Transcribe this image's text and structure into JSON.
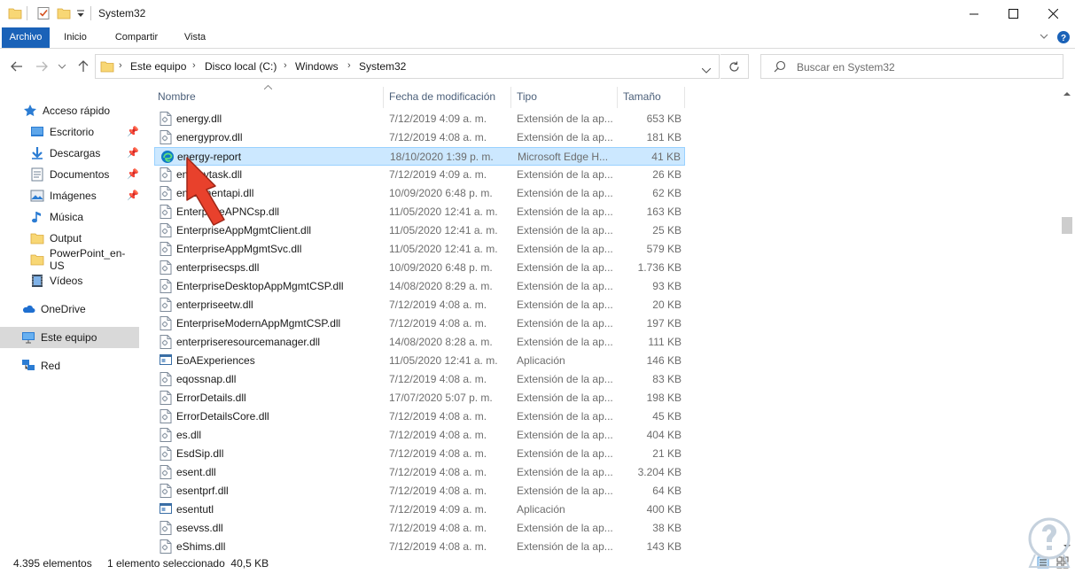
{
  "window": {
    "title": "System32"
  },
  "ribbon": {
    "tabs": [
      "Archivo",
      "Inicio",
      "Compartir",
      "Vista"
    ]
  },
  "address": {
    "crumbs": [
      "Este equipo",
      "Disco local (C:)",
      "Windows",
      "System32"
    ],
    "search_placeholder": "Buscar en System32"
  },
  "nav": {
    "items": [
      {
        "label": "Acceso rápido",
        "icon": "star-icon",
        "pinned": false
      },
      {
        "label": "Escritorio",
        "icon": "desktop-icon",
        "pinned": true
      },
      {
        "label": "Descargas",
        "icon": "download-icon",
        "pinned": true
      },
      {
        "label": "Documentos",
        "icon": "documents-icon",
        "pinned": true
      },
      {
        "label": "Imágenes",
        "icon": "pictures-icon",
        "pinned": true
      },
      {
        "label": "Música",
        "icon": "music-icon",
        "pinned": false
      },
      {
        "label": "Output",
        "icon": "folder-icon",
        "pinned": false
      },
      {
        "label": "PowerPoint_en-US",
        "icon": "folder-icon",
        "pinned": false
      },
      {
        "label": "Vídeos",
        "icon": "videos-icon",
        "pinned": false
      },
      {
        "label": "OneDrive",
        "icon": "cloud-icon",
        "pinned": false
      },
      {
        "label": "Este equipo",
        "icon": "computer-icon",
        "pinned": false
      },
      {
        "label": "Red",
        "icon": "network-icon",
        "pinned": false
      }
    ]
  },
  "columns": {
    "name": "Nombre",
    "date": "Fecha de modificación",
    "type": "Tipo",
    "size": "Tamaño"
  },
  "files": [
    {
      "name": "energy.dll",
      "date": "7/12/2019 4:09 a. m.",
      "type": "Extensión de la ap...",
      "size": "653 KB",
      "icon": "dll-icon"
    },
    {
      "name": "energyprov.dll",
      "date": "7/12/2019 4:08 a. m.",
      "type": "Extensión de la ap...",
      "size": "181 KB",
      "icon": "dll-icon"
    },
    {
      "name": "energy-report",
      "date": "18/10/2020 1:39 p. m.",
      "type": "Microsoft Edge H...",
      "size": "41 KB",
      "icon": "edge-icon"
    },
    {
      "name": "energytask.dll",
      "date": "7/12/2019 4:09 a. m.",
      "type": "Extensión de la ap...",
      "size": "26 KB",
      "icon": "dll-icon"
    },
    {
      "name": "enrollmentapi.dll",
      "date": "10/09/2020 6:48 p. m.",
      "type": "Extensión de la ap...",
      "size": "62 KB",
      "icon": "dll-icon"
    },
    {
      "name": "EnterpriseAPNCsp.dll",
      "date": "11/05/2020 12:41 a. m.",
      "type": "Extensión de la ap...",
      "size": "163 KB",
      "icon": "dll-icon"
    },
    {
      "name": "EnterpriseAppMgmtClient.dll",
      "date": "11/05/2020 12:41 a. m.",
      "type": "Extensión de la ap...",
      "size": "25 KB",
      "icon": "dll-icon"
    },
    {
      "name": "EnterpriseAppMgmtSvc.dll",
      "date": "11/05/2020 12:41 a. m.",
      "type": "Extensión de la ap...",
      "size": "579 KB",
      "icon": "dll-icon"
    },
    {
      "name": "enterprisecsps.dll",
      "date": "10/09/2020 6:48 p. m.",
      "type": "Extensión de la ap...",
      "size": "1.736 KB",
      "icon": "dll-icon"
    },
    {
      "name": "EnterpriseDesktopAppMgmtCSP.dll",
      "date": "14/08/2020 8:29 a. m.",
      "type": "Extensión de la ap...",
      "size": "93 KB",
      "icon": "dll-icon"
    },
    {
      "name": "enterpriseetw.dll",
      "date": "7/12/2019 4:08 a. m.",
      "type": "Extensión de la ap...",
      "size": "20 KB",
      "icon": "dll-icon"
    },
    {
      "name": "EnterpriseModernAppMgmtCSP.dll",
      "date": "7/12/2019 4:08 a. m.",
      "type": "Extensión de la ap...",
      "size": "197 KB",
      "icon": "dll-icon"
    },
    {
      "name": "enterpriseresourcemanager.dll",
      "date": "14/08/2020 8:28 a. m.",
      "type": "Extensión de la ap...",
      "size": "111 KB",
      "icon": "dll-icon"
    },
    {
      "name": "EoAExperiences",
      "date": "11/05/2020 12:41 a. m.",
      "type": "Aplicación",
      "size": "146 KB",
      "icon": "app-icon"
    },
    {
      "name": "eqossnap.dll",
      "date": "7/12/2019 4:08 a. m.",
      "type": "Extensión de la ap...",
      "size": "83 KB",
      "icon": "dll-icon"
    },
    {
      "name": "ErrorDetails.dll",
      "date": "17/07/2020 5:07 p. m.",
      "type": "Extensión de la ap...",
      "size": "198 KB",
      "icon": "dll-icon"
    },
    {
      "name": "ErrorDetailsCore.dll",
      "date": "7/12/2019 4:08 a. m.",
      "type": "Extensión de la ap...",
      "size": "45 KB",
      "icon": "dll-icon"
    },
    {
      "name": "es.dll",
      "date": "7/12/2019 4:08 a. m.",
      "type": "Extensión de la ap...",
      "size": "404 KB",
      "icon": "dll-icon"
    },
    {
      "name": "EsdSip.dll",
      "date": "7/12/2019 4:08 a. m.",
      "type": "Extensión de la ap...",
      "size": "21 KB",
      "icon": "dll-icon"
    },
    {
      "name": "esent.dll",
      "date": "7/12/2019 4:08 a. m.",
      "type": "Extensión de la ap...",
      "size": "3.204 KB",
      "icon": "dll-icon"
    },
    {
      "name": "esentprf.dll",
      "date": "7/12/2019 4:08 a. m.",
      "type": "Extensión de la ap...",
      "size": "64 KB",
      "icon": "dll-icon"
    },
    {
      "name": "esentutl",
      "date": "7/12/2019 4:09 a. m.",
      "type": "Aplicación",
      "size": "400 KB",
      "icon": "app-icon"
    },
    {
      "name": "esevss.dll",
      "date": "7/12/2019 4:08 a. m.",
      "type": "Extensión de la ap...",
      "size": "38 KB",
      "icon": "dll-icon"
    },
    {
      "name": "eShims.dll",
      "date": "7/12/2019 4:08 a. m.",
      "type": "Extensión de la ap...",
      "size": "143 KB",
      "icon": "dll-icon"
    }
  ],
  "selected_index": 2,
  "status": {
    "count": "4.395 elementos",
    "selection": "1 elemento seleccionado  40,5 KB"
  },
  "colors": {
    "accent": "#1a62b8",
    "selection_bg": "#cce8ff",
    "selection_border": "#99d1ff",
    "annotation_arrow": "#e8412c"
  }
}
